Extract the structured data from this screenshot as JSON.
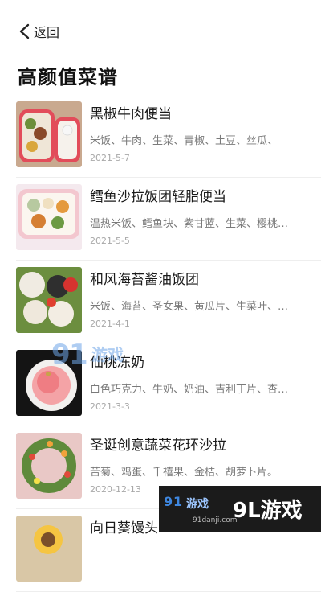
{
  "header": {
    "back_label": "返回",
    "page_title": "高颜值菜谱"
  },
  "recipes": [
    {
      "name": "黑椒牛肉便当",
      "ingredients": "米饭、牛肉、生菜、青椒、土豆、丝瓜、",
      "date": "2021-5-7"
    },
    {
      "name": "鳕鱼沙拉饭团轻脂便当",
      "ingredients": "温热米饭、鳕鱼块、紫甘蓝、生菜、樱桃…",
      "date": "2021-5-5"
    },
    {
      "name": "和风海苔酱油饭团",
      "ingredients": "米饭、海苔、圣女果、黄瓜片、生菜叶、…",
      "date": "2021-4-1"
    },
    {
      "name": "仙桃冻奶",
      "ingredients": "白色巧克力、牛奶、奶油、吉利丁片、杏…",
      "date": "2021-3-3"
    },
    {
      "name": "圣诞创意蔬菜花环沙拉",
      "ingredients": "苦菊、鸡蛋、千禧果、金桔、胡萝卜片。",
      "date": "2020-12-13"
    },
    {
      "name": "向日葵馒头",
      "ingredients": "",
      "date": ""
    }
  ],
  "watermark": {
    "logo_num": "9",
    "logo_text": "游戏",
    "site": "91danji.com",
    "big_text": "9L游戏"
  },
  "colors": {
    "accent_pink": "#e8606c",
    "text_primary": "#1a1a1a",
    "text_secondary": "#7a7a7a",
    "text_meta": "#a8a8a8"
  }
}
